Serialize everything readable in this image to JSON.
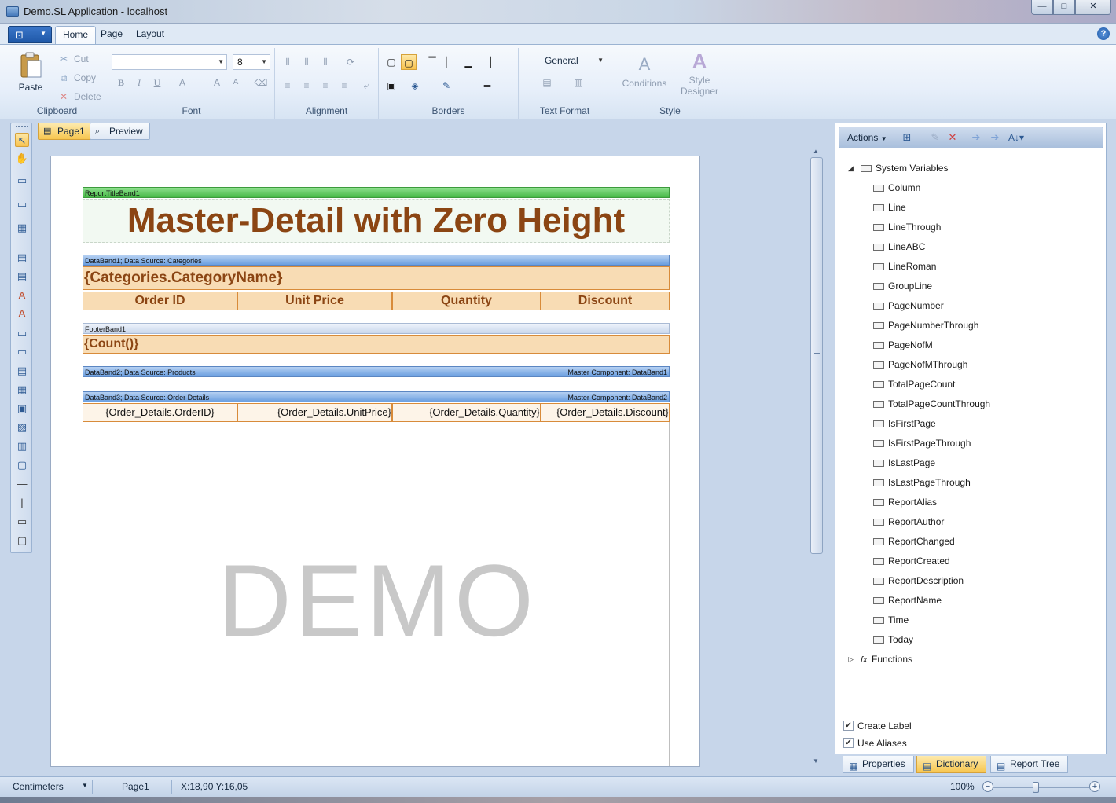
{
  "window": {
    "title": "Demo.SL Application - localhost",
    "minimize": "—",
    "maximize": "□",
    "close": "✕"
  },
  "ribbon": {
    "tabs": [
      "Home",
      "Page",
      "Layout"
    ],
    "active_tab": "Home",
    "clipboard": {
      "label": "Clipboard",
      "paste": "Paste",
      "cut": "Cut",
      "copy": "Copy",
      "delete": "Delete"
    },
    "font": {
      "label": "Font",
      "family_value": "",
      "size_value": "8"
    },
    "alignment": {
      "label": "Alignment"
    },
    "borders": {
      "label": "Borders"
    },
    "text_format": {
      "label": "Text Format",
      "format_value": "General"
    },
    "style": {
      "label": "Style",
      "conditions": "Conditions",
      "style_designer_line1": "Style",
      "style_designer_line2": "Designer"
    }
  },
  "page_tabs": [
    {
      "label": "Page1",
      "active": true
    },
    {
      "label": "Preview",
      "active": false
    }
  ],
  "report": {
    "report_title_band": "ReportTitleBand1",
    "title_text": "Master-Detail with Zero Height",
    "databand1": "DataBand1; Data Source: Categories",
    "category_name": "{Categories.CategoryName}",
    "headers": [
      "Order ID",
      "Unit Price",
      "Quantity",
      "Discount"
    ],
    "footer_band": "FooterBand1",
    "count": "{Count()}",
    "databand2": "DataBand2; Data Source: Products",
    "databand2_master": "Master Component: DataBand1",
    "databand3": "DataBand3; Data Source: Order Details",
    "databand3_master": "Master Component: DataBand2",
    "detail_cells": [
      "{Order_Details.OrderID}",
      "{Order_Details.UnitPrice}",
      "{Order_Details.Quantity}",
      "{Order_Details.Discount}"
    ],
    "watermark": "DEMO"
  },
  "dictionary": {
    "actions_label": "Actions",
    "system_variables": "System Variables",
    "variables": [
      "Column",
      "Line",
      "LineThrough",
      "LineABC",
      "LineRoman",
      "GroupLine",
      "PageNumber",
      "PageNumberThrough",
      "PageNofM",
      "PageNofMThrough",
      "TotalPageCount",
      "TotalPageCountThrough",
      "IsFirstPage",
      "IsFirstPageThrough",
      "IsLastPage",
      "IsLastPageThrough",
      "ReportAlias",
      "ReportAuthor",
      "ReportChanged",
      "ReportCreated",
      "ReportDescription",
      "ReportName",
      "Time",
      "Today"
    ],
    "functions": "Functions",
    "create_label": "Create Label",
    "use_aliases": "Use Aliases"
  },
  "dock_tabs": [
    {
      "label": "Properties",
      "active": false
    },
    {
      "label": "Dictionary",
      "active": true
    },
    {
      "label": "Report Tree",
      "active": false
    }
  ],
  "status": {
    "unit": "Centimeters",
    "page": "Page1",
    "coords": "X:18,90  Y:16,05",
    "zoom": "100%"
  }
}
